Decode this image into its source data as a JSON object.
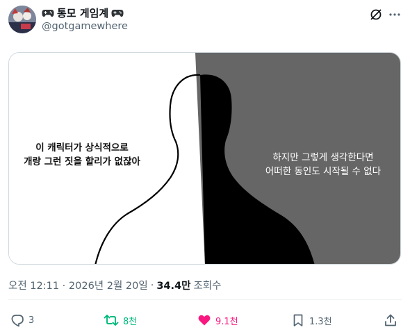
{
  "post": {
    "display_name": "통모 게임계",
    "handle": "@gotgamewhere",
    "timestamp": "오전 12:11 · 2026년 2월 20일",
    "separator": "·",
    "views_count": "34.4만",
    "views_label": "조회수"
  },
  "image": {
    "left_caption_line1": "이 캐릭터가 상식적으로",
    "left_caption_line2": "개랑 그런 짓을 할리가 없잖아",
    "right_caption_line1": "하지만 그렇게 생각한다면",
    "right_caption_line2": "어떠한 동인도 시작될 수 없다"
  },
  "actions": {
    "replies": "3",
    "reposts": "8천",
    "likes": "9.1천",
    "bookmarks": "1.3천"
  },
  "colors": {
    "repost_green": "#00ba7c",
    "like_pink": "#f91880",
    "icon_gray": "#536471",
    "dark_panel": "#666666"
  },
  "icons": {
    "gamepad": "gamepad-icon",
    "grok": "grok-icon",
    "more": "more-icon",
    "reply": "reply-icon",
    "repost": "repost-icon",
    "like": "heart-icon",
    "bookmark": "bookmark-icon",
    "share": "share-icon"
  }
}
